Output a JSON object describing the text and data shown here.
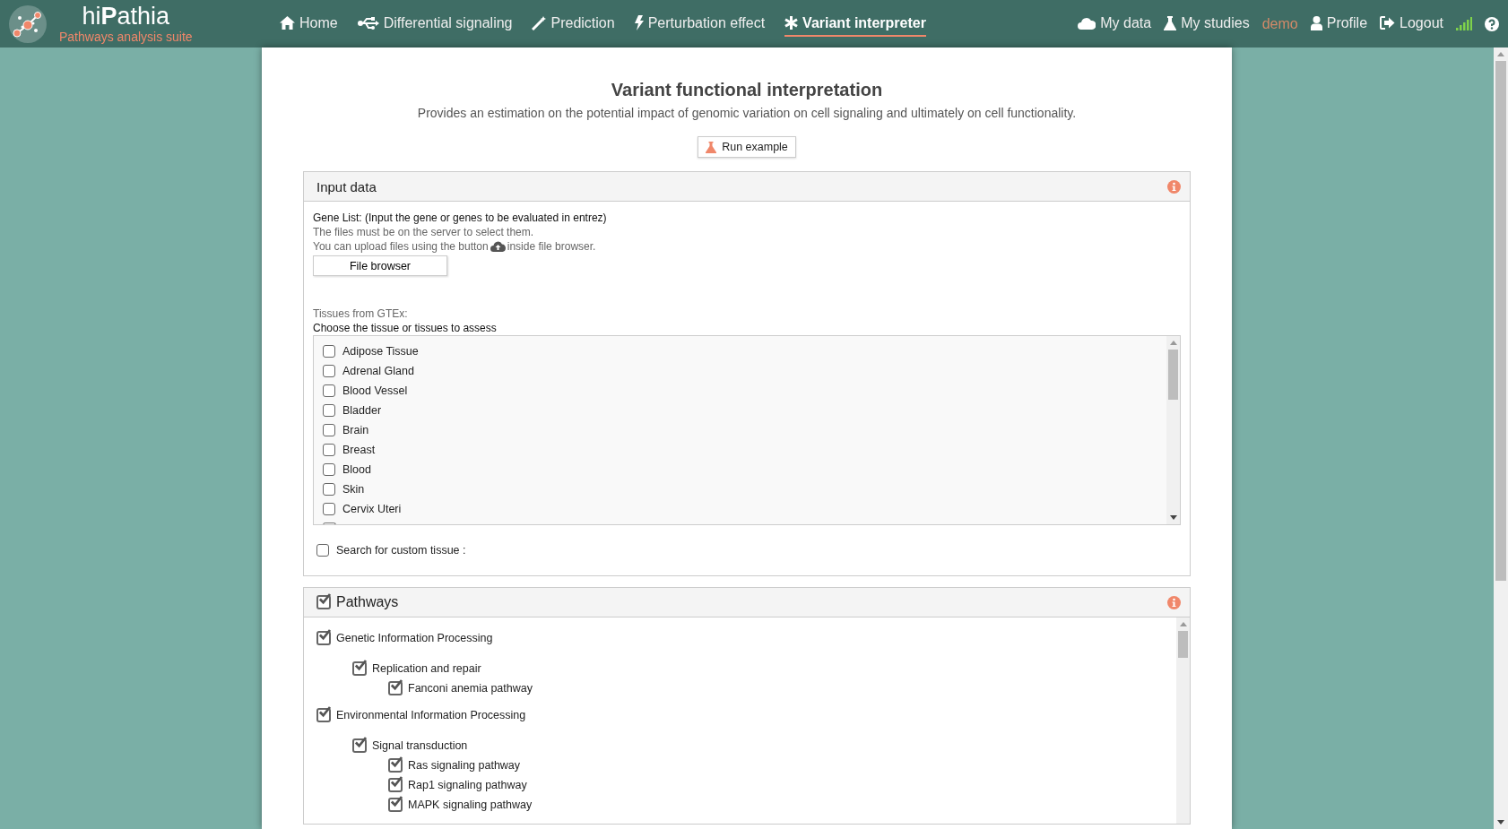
{
  "brand": {
    "name_start": "hi",
    "name_bold": "P",
    "name_end": "athia",
    "tagline": "Pathways analysis suite"
  },
  "nav": [
    {
      "label": "Home",
      "selected": false
    },
    {
      "label": "Differential signaling",
      "selected": false
    },
    {
      "label": "Prediction",
      "selected": false
    },
    {
      "label": "Perturbation effect",
      "selected": false
    },
    {
      "label": "Variant interpreter",
      "selected": true
    }
  ],
  "nav_right": [
    {
      "label": "My data",
      "kind": "link"
    },
    {
      "label": "My studies",
      "kind": "link"
    },
    {
      "label": "demo",
      "kind": "user"
    },
    {
      "label": "Profile",
      "kind": "link"
    },
    {
      "label": "Logout",
      "kind": "link"
    }
  ],
  "page": {
    "title": "Variant functional interpretation",
    "subtitle": "Provides an estimation on the potential impact of genomic variation on cell signaling and ultimately on cell functionality.",
    "run_example": "Run example"
  },
  "input_panel": {
    "title": "Input data",
    "gene_label": "Gene List: (Input the gene or genes to be evaluated in entrez)",
    "hint_1": "The files must be on the server to select them.",
    "hint_2_start": "You can upload files using the button",
    "hint_2_end": "inside file browser.",
    "file_button": "File browser",
    "tissues_source": "Tissues from GTEx:",
    "tissues_label": "Choose the tissue or tissues to assess",
    "tissues": [
      {
        "label": "Adipose Tissue",
        "checked": false
      },
      {
        "label": "Adrenal Gland",
        "checked": false
      },
      {
        "label": "Blood Vessel",
        "checked": false
      },
      {
        "label": "Bladder",
        "checked": false
      },
      {
        "label": "Brain",
        "checked": false
      },
      {
        "label": "Breast",
        "checked": false
      },
      {
        "label": "Blood",
        "checked": false
      },
      {
        "label": "Skin",
        "checked": false
      },
      {
        "label": "Cervix Uteri",
        "checked": false
      }
    ],
    "custom_tissue": {
      "label": "Search for custom tissue :",
      "checked": false
    }
  },
  "pathways_panel": {
    "title": "Pathways",
    "checked": true,
    "tree": [
      {
        "label": "Genetic Information Processing",
        "checked": true,
        "children": [
          {
            "label": "Replication and repair",
            "checked": true,
            "children": [
              {
                "label": "Fanconi anemia pathway",
                "checked": true
              }
            ]
          }
        ]
      },
      {
        "label": "Environmental Information Processing",
        "checked": true,
        "children": [
          {
            "label": "Signal transduction",
            "checked": true,
            "children": [
              {
                "label": "Ras signaling pathway",
                "checked": true
              },
              {
                "label": "Rap1 signaling pathway",
                "checked": true
              },
              {
                "label": "MAPK signaling pathway",
                "checked": true
              }
            ]
          }
        ]
      }
    ]
  }
}
